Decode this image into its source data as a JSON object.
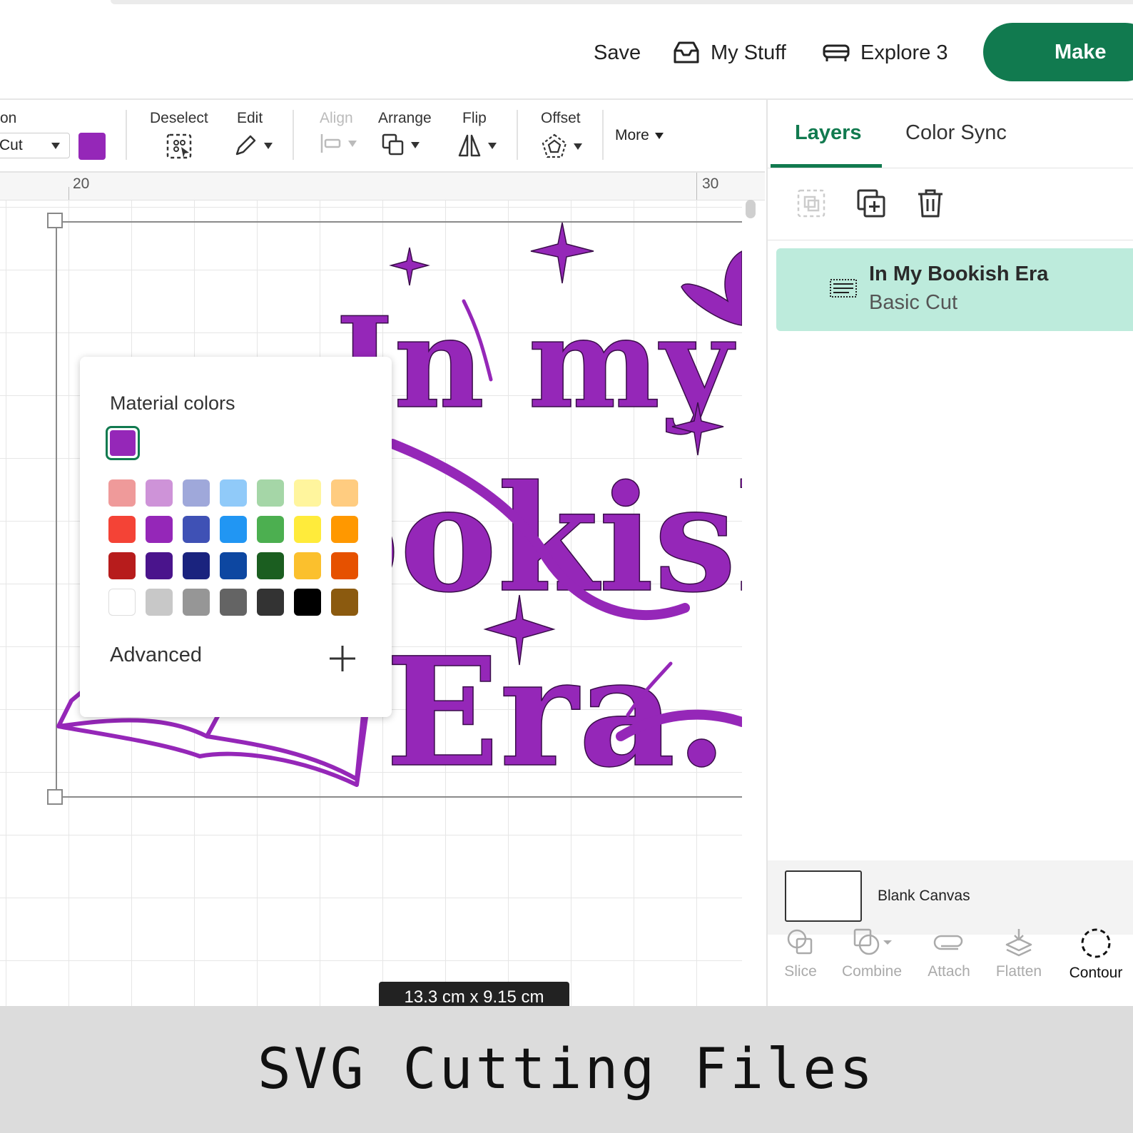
{
  "header": {
    "save_label": "Save",
    "mystuff_label": "My Stuff",
    "explore_label": "Explore 3",
    "make_label": "Make"
  },
  "toolbar": {
    "operation_label_partial": "on",
    "operation_value_partial": "Cut",
    "selected_color": "#9527b8",
    "deselect_label": "Deselect",
    "edit_label": "Edit",
    "align_label": "Align",
    "arrange_label": "Arrange",
    "flip_label": "Flip",
    "offset_label": "Offset",
    "more_label": "More"
  },
  "ruler": {
    "left_number": "20",
    "right_number": "30"
  },
  "color_popover": {
    "title": "Material colors",
    "selected_color": "#9527b8",
    "swatches": [
      [
        "#ef9a9a",
        "#ce93d8",
        "#9fa8da",
        "#90caf9",
        "#a5d6a7",
        "#fff59d",
        "#ffcc80"
      ],
      [
        "#f44336",
        "#9527b8",
        "#3f51b5",
        "#2196f3",
        "#4caf50",
        "#ffeb3b",
        "#ff9800"
      ],
      [
        "#b71c1c",
        "#4a148c",
        "#1a237e",
        "#0d47a1",
        "#1b5e20",
        "#fbc02d",
        "#e65100"
      ],
      [
        "#ffffff",
        "#c8c8c8",
        "#969696",
        "#646464",
        "#333333",
        "#000000",
        "#8b5a0f"
      ]
    ],
    "advanced_label": "Advanced"
  },
  "design": {
    "line1": "In my",
    "line2": "Bookish",
    "line3": "Era.",
    "color": "#9527b8"
  },
  "dimension_label": "13.3  cm x 9.15  cm",
  "panel": {
    "tabs": [
      {
        "label": "Layers"
      },
      {
        "label": "Color Sync"
      }
    ],
    "layer": {
      "name": "In My Bookish Era",
      "operation": "Basic Cut"
    },
    "blank_canvas_label": "Blank Canvas",
    "actions": [
      {
        "label": "Slice"
      },
      {
        "label": "Combine"
      },
      {
        "label": "Attach"
      },
      {
        "label": "Flatten"
      },
      {
        "label": "Contour"
      }
    ]
  },
  "footer": {
    "text": "SVG Cutting Files"
  },
  "colors": {
    "brand_green": "#117a4f",
    "layer_highlight": "#bdebdc",
    "design_purple": "#9527b8"
  }
}
